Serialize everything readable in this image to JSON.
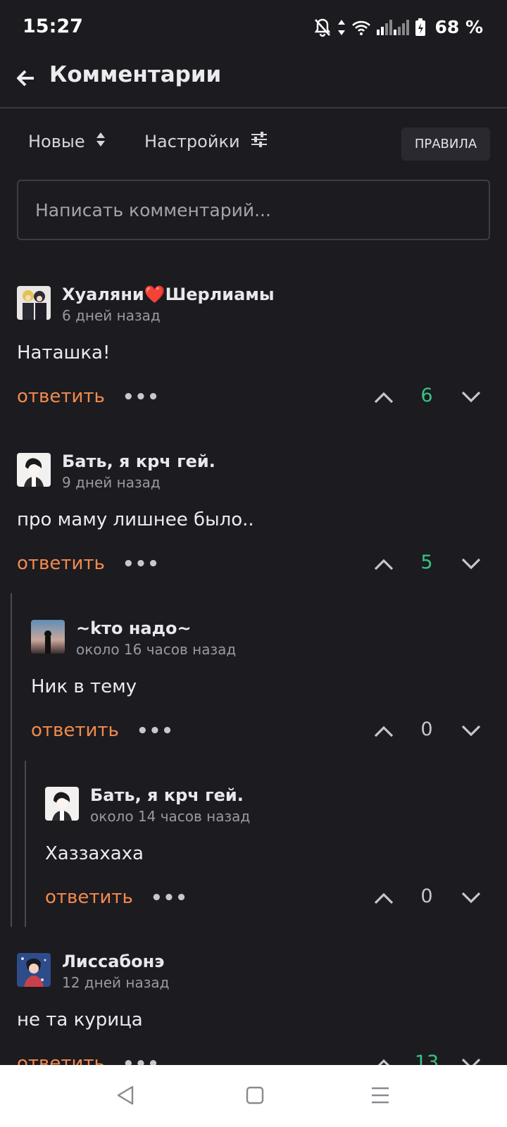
{
  "status_bar": {
    "time": "15:27",
    "battery": "68 %"
  },
  "header": {
    "title": "Комментарии"
  },
  "toolbar": {
    "sort_label": "Новые",
    "settings_label": "Настройки",
    "rules_label": "ПРАВИЛА"
  },
  "input": {
    "placeholder": "Написать комментарий..."
  },
  "actions": {
    "reply_label": "ответить",
    "more_label": "•••"
  },
  "comments": [
    {
      "author": "Хуаляни❤️Шерлиамы",
      "time": "6 дней назад",
      "text": "Наташка!",
      "score": "6"
    },
    {
      "author": "Бать, я крч гей.",
      "time": "9 дней назад",
      "text": "про маму лишнее было..",
      "score": "5"
    },
    {
      "author": "~kто надо~",
      "time": "около 16 часов назад",
      "text": "Ник в тему",
      "score": "0"
    },
    {
      "author": "Бать, я крч гей.",
      "time": "около 14 часов назад",
      "text": "Хаззахаха",
      "score": "0"
    },
    {
      "author": "Лиссабонэ",
      "time": "12 дней назад",
      "text": "не та курица",
      "score": "13"
    }
  ],
  "colors": {
    "background": "#1c1b20",
    "reply": "#f28a4d",
    "score_positive": "#37c383"
  }
}
